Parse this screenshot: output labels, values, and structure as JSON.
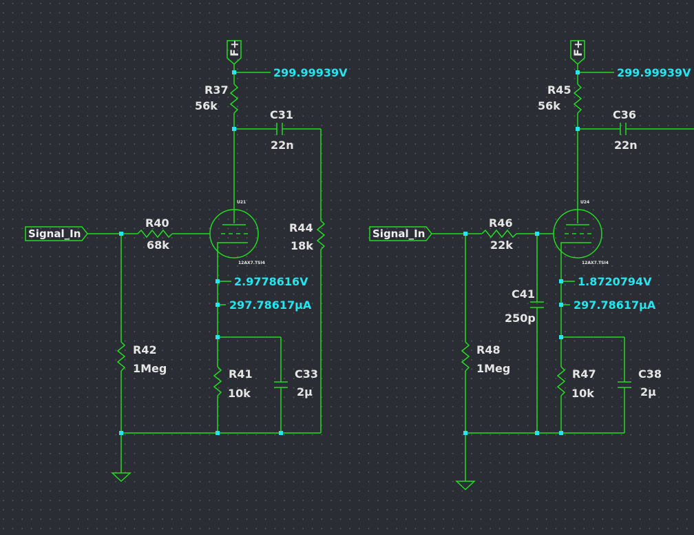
{
  "stage1": {
    "supply_label": "F+",
    "supply_probe": "299.99939V",
    "r_plate": {
      "ref": "R37",
      "value": "56k"
    },
    "c_couple": {
      "ref": "C31",
      "value": "22n"
    },
    "tube": {
      "ref": "U21",
      "model": "12AX7.TSI4"
    },
    "input_port": "Signal_In",
    "r_grid": {
      "ref": "R40",
      "value": "68k"
    },
    "r_load": {
      "ref": "R44",
      "value": "18k"
    },
    "cathode_voltage": "2.9778616V",
    "cathode_current": "297.78617µA",
    "r_leak": {
      "ref": "R42",
      "value": "1Meg"
    },
    "r_cathode": {
      "ref": "R41",
      "value": "10k"
    },
    "c_bypass": {
      "ref": "C33",
      "value": "2µ"
    }
  },
  "stage2": {
    "supply_label": "F+",
    "supply_probe": "299.99939V",
    "r_plate": {
      "ref": "R45",
      "value": "56k"
    },
    "c_couple": {
      "ref": "C36",
      "value": "22n"
    },
    "tube": {
      "ref": "U24",
      "model": "12AX7.TSI4"
    },
    "input_port": "Signal_In",
    "r_grid": {
      "ref": "R46",
      "value": "22k"
    },
    "c_shunt": {
      "ref": "C41",
      "value": "250p"
    },
    "cathode_voltage": "1.8720794V",
    "cathode_current": "297.78617µA",
    "r_leak": {
      "ref": "R48",
      "value": "1Meg"
    },
    "r_cathode": {
      "ref": "R47",
      "value": "10k"
    },
    "c_bypass": {
      "ref": "C38",
      "value": "2µ"
    }
  },
  "colors": {
    "background": "#2a2d33",
    "wire": "#22dd22",
    "probe": "#22e6f0",
    "label": "#e6e6e6"
  }
}
